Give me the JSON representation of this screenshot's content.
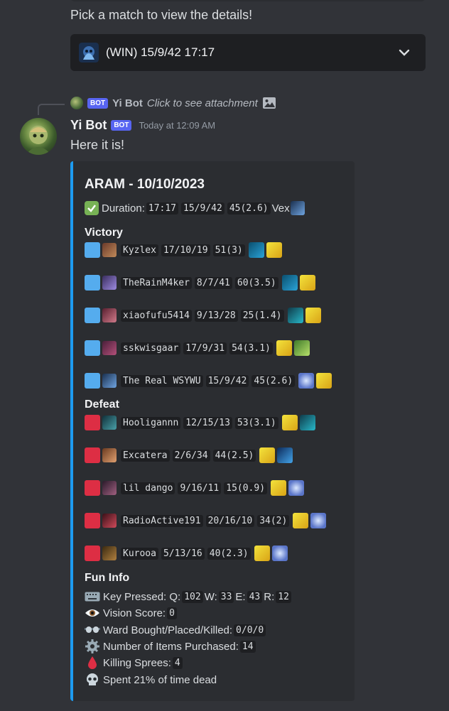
{
  "previous": {
    "prompt": "Pick a match to view the details!"
  },
  "select": {
    "value": "(WIN) 15/9/42 17:17"
  },
  "reply": {
    "badge": "BOT",
    "name": "Yi Bot",
    "attachment_text": "Click to see attachment"
  },
  "message": {
    "username": "Yi Bot",
    "badge": "BOT",
    "timestamp": "Today at 12:09 AM",
    "content": "Here it is!"
  },
  "embed": {
    "title": "ARAM - 10/10/2023",
    "accent_color": "#1d9bf0",
    "duration": {
      "label": "Duration:",
      "time": "17:17",
      "kda": "15/9/42",
      "cs": "45(2.6)",
      "champion": "Vex"
    },
    "victory_label": "Victory",
    "defeat_label": "Defeat",
    "victory": [
      {
        "name": "Kyzlex",
        "kda": "17/10/19",
        "cs": "51(3)",
        "spells": [
          "mark",
          "flash"
        ]
      },
      {
        "name": "TheRainM4ker",
        "kda": "8/7/41",
        "cs": "60(3.5)",
        "spells": [
          "mark",
          "flash"
        ]
      },
      {
        "name": "xiaofufu5414",
        "kda": "9/13/28",
        "cs": "25(1.4)",
        "spells": [
          "ghost",
          "flash"
        ]
      },
      {
        "name": "sskwisgaar",
        "kda": "17/9/31",
        "cs": "54(3.1)",
        "spells": [
          "flash",
          "heal"
        ]
      },
      {
        "name": "The Real WSYWU",
        "kda": "15/9/42",
        "cs": "45(2.6)",
        "spells": [
          "snowball",
          "flash"
        ]
      }
    ],
    "defeat": [
      {
        "name": "Hooligannn",
        "kda": "12/15/13",
        "cs": "53(3.1)",
        "spells": [
          "flash",
          "ghost"
        ]
      },
      {
        "name": "Excatera",
        "kda": "2/6/34",
        "cs": "44(2.5)",
        "spells": [
          "flash",
          "clarity"
        ]
      },
      {
        "name": "lil dango",
        "kda": "9/16/11",
        "cs": "15(0.9)",
        "spells": [
          "flash",
          "snowball"
        ]
      },
      {
        "name": "RadioActive191",
        "kda": "20/16/10",
        "cs": "34(2)",
        "spells": [
          "flash",
          "snowball"
        ]
      },
      {
        "name": "Kurooa",
        "kda": "5/13/16",
        "cs": "40(2.3)",
        "spells": [
          "flash",
          "snowball"
        ]
      }
    ],
    "fun_info": {
      "title": "Fun Info",
      "keys_label": "Key Pressed: Q:",
      "q": "102",
      "w_label": "W:",
      "w": "33",
      "e_label": "E:",
      "e": "43",
      "r_label": "R:",
      "r": "12",
      "vision_label": "Vision Score:",
      "vision": "0",
      "ward_label": "Ward Bought/Placed/Killed:",
      "ward": "0/0/0",
      "items_label": "Number of Items Purchased:",
      "items": "14",
      "sprees_label": "Killing Sprees:",
      "sprees": "4",
      "dead_text": "Spent 21% of time dead"
    }
  }
}
